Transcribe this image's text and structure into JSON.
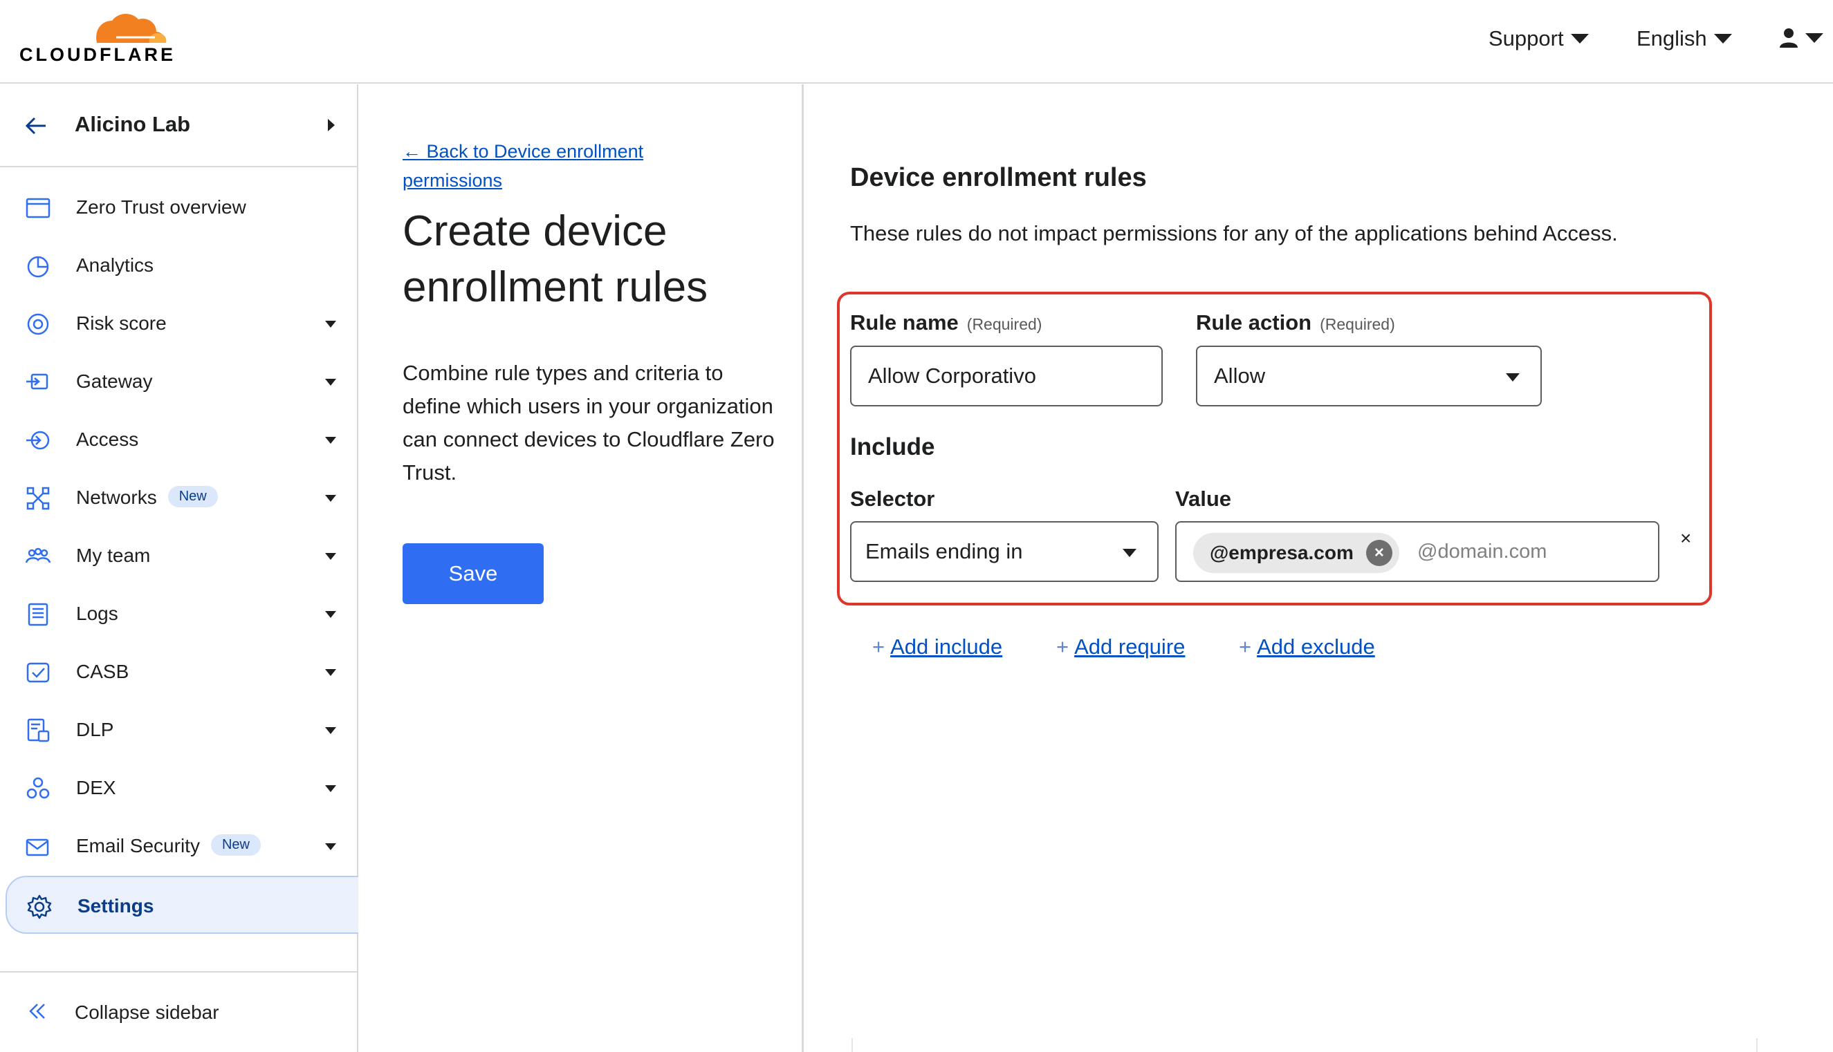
{
  "header": {
    "logo_text": "CLOUDFLARE",
    "menus": [
      {
        "label": "Support"
      },
      {
        "label": "English"
      }
    ],
    "user_icon": "user-icon"
  },
  "sidebar": {
    "account_name": "Alicino Lab",
    "items": [
      {
        "label": "Zero Trust overview",
        "icon": "browser-window-icon",
        "has_caret": false
      },
      {
        "label": "Analytics",
        "icon": "pie-chart-icon",
        "has_caret": false
      },
      {
        "label": "Risk score",
        "icon": "risk-gauge-icon",
        "has_caret": true
      },
      {
        "label": "Gateway",
        "icon": "gateway-icon",
        "has_caret": true
      },
      {
        "label": "Access",
        "icon": "access-icon",
        "has_caret": true
      },
      {
        "label": "Networks",
        "icon": "network-icon",
        "has_caret": true,
        "badge": "New"
      },
      {
        "label": "My team",
        "icon": "team-icon",
        "has_caret": true
      },
      {
        "label": "Logs",
        "icon": "logs-icon",
        "has_caret": true
      },
      {
        "label": "CASB",
        "icon": "casb-icon",
        "has_caret": true
      },
      {
        "label": "DLP",
        "icon": "dlp-icon",
        "has_caret": true
      },
      {
        "label": "DEX",
        "icon": "dex-icon",
        "has_caret": true
      },
      {
        "label": "Email Security",
        "icon": "email-security-icon",
        "has_caret": true,
        "badge": "New"
      },
      {
        "label": "Settings",
        "icon": "gear-icon",
        "has_caret": false,
        "active": true
      }
    ],
    "collapse_label": "Collapse sidebar"
  },
  "main": {
    "back_link": "← Back to Device enrollment permissions",
    "title": "Create device enrollment rules",
    "description": "Combine rule types and criteria to define which users in your organization can connect devices to Cloudflare Zero Trust.",
    "save_label": "Save"
  },
  "rules": {
    "section_title": "Device enrollment rules",
    "section_desc": "These rules do not impact permissions for any of the applications behind Access.",
    "rule_name_label": "Rule name",
    "rule_action_label": "Rule action",
    "required_text": "(Required)",
    "rule_name_value": "Allow Corporativo",
    "rule_action_value": "Allow",
    "include_title": "Include",
    "selector_label": "Selector",
    "value_label": "Value",
    "selector_value": "Emails ending in",
    "value_chip": "@empresa.com",
    "value_placeholder": "@domain.com",
    "chip_remove": "×",
    "row_remove": "×",
    "add_links": [
      {
        "label": "Add include"
      },
      {
        "label": "Add require"
      },
      {
        "label": "Add exclude"
      }
    ]
  },
  "colors": {
    "accent": "#2f6ef3",
    "link": "#0051c3",
    "highlight_border": "#e0352b",
    "logo_orange": "#f38020",
    "logo_light": "#faad3f",
    "active_bg": "#eaf1fd"
  }
}
